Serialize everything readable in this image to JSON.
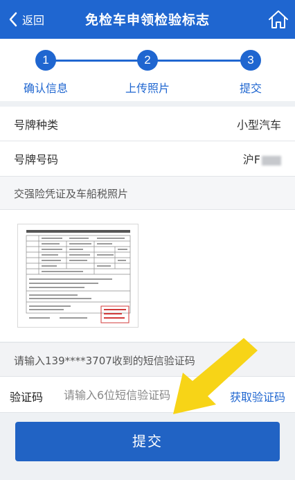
{
  "header": {
    "back_label": "返回",
    "title": "免检车申领检验标志"
  },
  "steps": [
    {
      "number": "1",
      "label": "确认信息"
    },
    {
      "number": "2",
      "label": "上传照片"
    },
    {
      "number": "3",
      "label": "提交"
    }
  ],
  "vehicle": {
    "plate_type_label": "号牌种类",
    "plate_type_value": "小型汽车",
    "plate_number_label": "号牌号码",
    "plate_number_value": "沪F"
  },
  "photos": {
    "section_title": "交强险凭证及车船税照片"
  },
  "verification": {
    "sms_tip": "请输入139****3707收到的短信验证码",
    "code_label": "验证码",
    "code_placeholder": "请输入6位短信验证码",
    "get_code_label": "获取验证码"
  },
  "submit_label": "提交",
  "colors": {
    "brand": "#1f66d0",
    "annotation_arrow": "#f7d417"
  }
}
